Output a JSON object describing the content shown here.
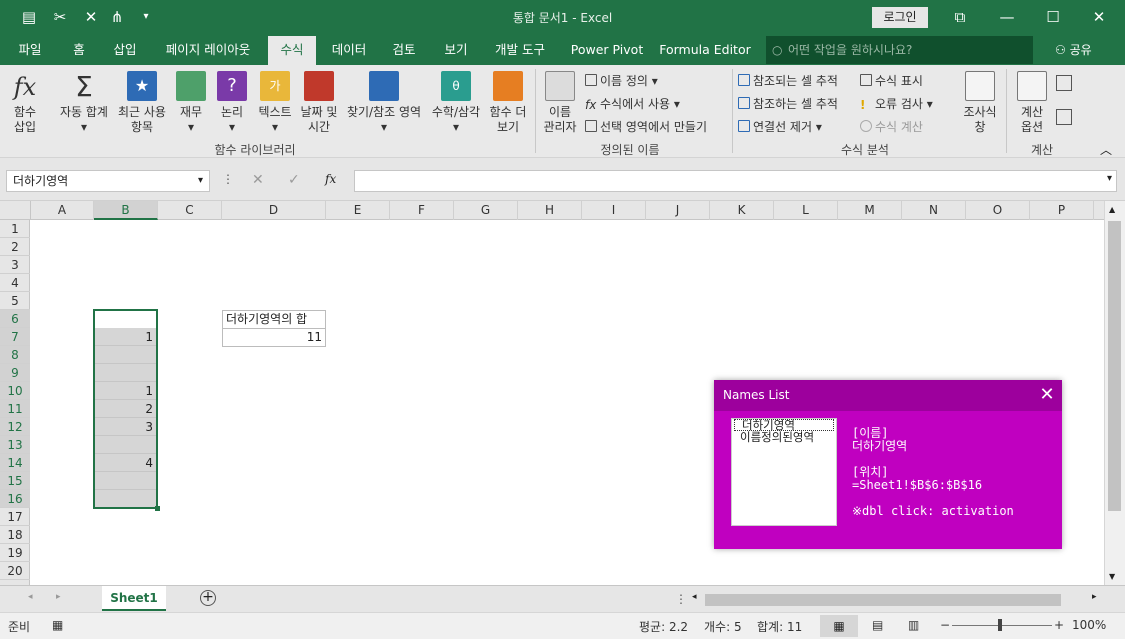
{
  "window": {
    "title": "통합 문서1  -  Excel",
    "login": "로그인"
  },
  "tabs": [
    "파일",
    "홈",
    "삽입",
    "페이지 레이아웃",
    "수식",
    "데이터",
    "검토",
    "보기",
    "개발 도구",
    "Power Pivot",
    "Formula Editor"
  ],
  "tellme": "어떤 작업을 원하시나요?",
  "share": "공유",
  "ribbon": {
    "insert_function": [
      "함수",
      "삽입"
    ],
    "autosum": [
      "자동 합계",
      ""
    ],
    "recent": [
      "최근 사용",
      "항목"
    ],
    "finance": [
      "재무",
      ""
    ],
    "logic": [
      "논리",
      ""
    ],
    "text": [
      "텍스트",
      ""
    ],
    "datetime": [
      "날짜 및",
      "시간"
    ],
    "lookup": [
      "찾기/참조 영역",
      ""
    ],
    "math": [
      "수학/삼각",
      ""
    ],
    "more": [
      "함수 더",
      "보기"
    ],
    "group_library": "함수 라이브러리",
    "name_manager": [
      "이름",
      "관리자"
    ],
    "define_name": "이름 정의",
    "use_in_formula": "수식에서 사용",
    "create_from_sel": "선택 영역에서 만들기",
    "group_names": "정의된 이름",
    "trace_precedents": "참조되는 셀 추적",
    "trace_dependents": "참조하는 셀 추적",
    "remove_arrows": "연결선 제거",
    "show_formulas": "수식 표시",
    "error_check": "오류 검사",
    "evaluate": "수식 계산",
    "watch": [
      "조사식",
      "창"
    ],
    "group_audit": "수식 분석",
    "calc_options": [
      "계산",
      "옵션"
    ],
    "group_calc": "계산"
  },
  "namebox": "더하기영역",
  "fx": "fx",
  "columns": [
    "A",
    "B",
    "C",
    "D",
    "E",
    "F",
    "G",
    "H",
    "I",
    "J",
    "K",
    "L",
    "M",
    "N",
    "O",
    "P"
  ],
  "rows": [
    "1",
    "2",
    "3",
    "4",
    "5",
    "6",
    "7",
    "8",
    "9",
    "10",
    "11",
    "12",
    "13",
    "14",
    "15",
    "16",
    "17",
    "18",
    "19",
    "20"
  ],
  "cells": {
    "b6": "",
    "b7": "1",
    "b8": "",
    "b9": "",
    "b10": "1",
    "b11": "2",
    "b12": "3",
    "b13": "",
    "b14": "4",
    "b15": "",
    "b16": "",
    "d6": "더하기영역의 합",
    "d7": "11"
  },
  "sheet": "Sheet1",
  "status": {
    "ready": "준비",
    "average": "평균: 2.2",
    "count": "개수: 5",
    "sum": "합계: 11",
    "zoom": "100%"
  },
  "dialog": {
    "title": "Names List",
    "items": [
      "더하기영역",
      "이름정의된영역"
    ],
    "name_label": "[이름]",
    "name_value": "더하기영역",
    "loc_label": "[위치]",
    "loc_value": "=Sheet1!$B$6:$B$16",
    "hint": "※dbl click: activation"
  }
}
